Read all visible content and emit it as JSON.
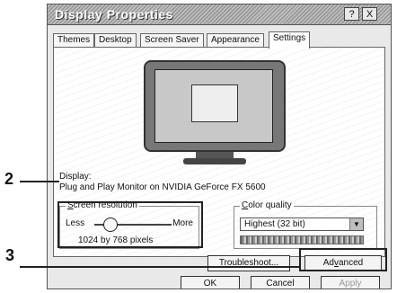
{
  "window": {
    "title": "Display Properties",
    "help_label": "?",
    "close_label": "X"
  },
  "tabs": [
    "Themes",
    "Desktop",
    "Screen Saver",
    "Appearance",
    "Settings"
  ],
  "active_tab": "Settings",
  "display": {
    "label": "Display:",
    "value": "Plug and Play Monitor on NVIDIA GeForce FX 5600"
  },
  "screen_resolution": {
    "label_first": "S",
    "label_rest": "creen resolution",
    "less": "Less",
    "more": "More",
    "value": "1024 by 768 pixels"
  },
  "color_quality": {
    "label_first": "C",
    "label_rest": "olor quality",
    "value": "Highest (32 bit)"
  },
  "buttons": {
    "troubleshoot_first": "T",
    "troubleshoot_rest": "roubleshoot...",
    "advanced_pre": "Ad",
    "advanced_u": "v",
    "advanced_post": "anced",
    "ok": "OK",
    "cancel": "Cancel",
    "apply": "Apply"
  },
  "callouts": {
    "one": "2",
    "two": "3"
  },
  "icons": {
    "arrow": "dropdown-arrow",
    "monitor": "monitor-preview"
  }
}
